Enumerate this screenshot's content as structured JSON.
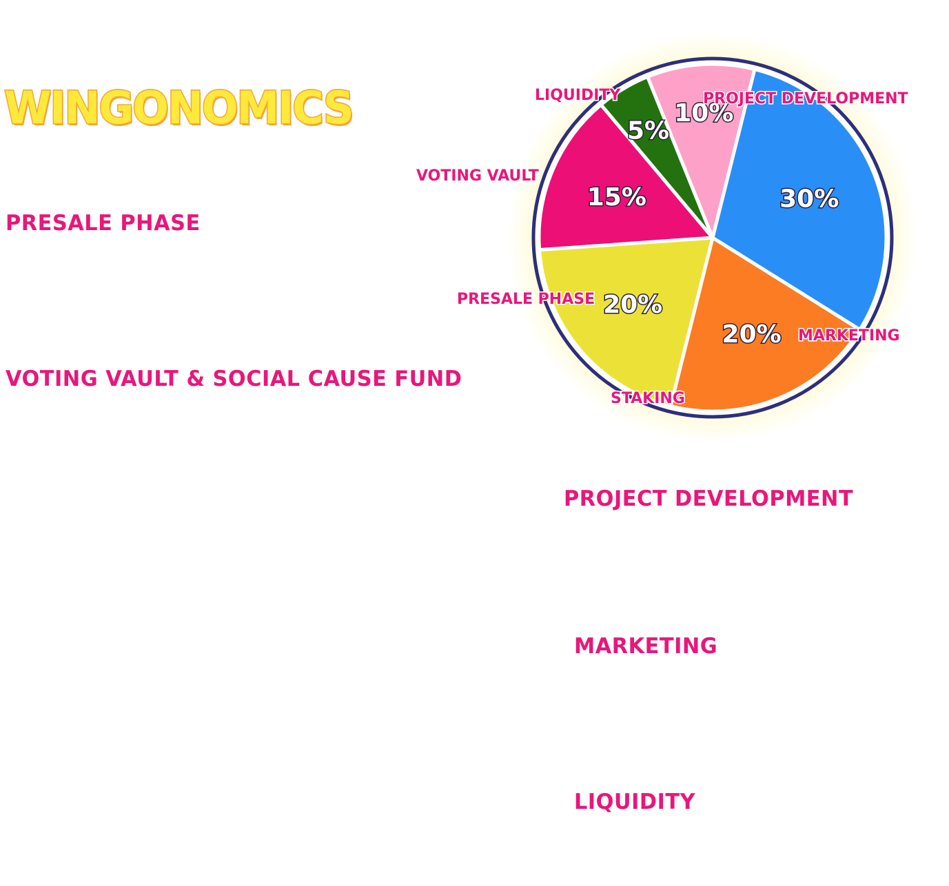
{
  "title": "WINGONOMICS",
  "sections": {
    "presale": "PRESALE PHASE",
    "voting": "VOTING VAULT & SOCIAL CAUSE FUND",
    "project": "PROJECT DEVELOPMENT",
    "marketing": "MARKETING",
    "liquidity": "LIQUIDITY"
  },
  "colors": {
    "heading": "#e8177a",
    "title_fill": "#ffe93b",
    "title_stroke": "#f2a63a",
    "pie_border": "#2d2f7a",
    "glow": "#fff6a8"
  },
  "chart_data": {
    "type": "pie",
    "start_angle_deg": 14,
    "slices": [
      {
        "name": "PROJECT DEVELOPMENT",
        "value": 30,
        "label": "30%",
        "color": "#2a8ef7"
      },
      {
        "name": "MARKETING",
        "value": 20,
        "label": "20%",
        "color": "#fc7c23"
      },
      {
        "name": "STAKING",
        "value": 20,
        "label": "20%",
        "color": "#ece237"
      },
      {
        "name": "PRESALE PHASE",
        "value": 15,
        "label": "15%",
        "color": "#ec0f76"
      },
      {
        "name": "VOTING VAULT",
        "value": 5,
        "label": "5%",
        "color": "#24720f"
      },
      {
        "name": "LIQUIDITY",
        "value": 10,
        "label": "10%",
        "color": "#fea1c9"
      }
    ]
  }
}
